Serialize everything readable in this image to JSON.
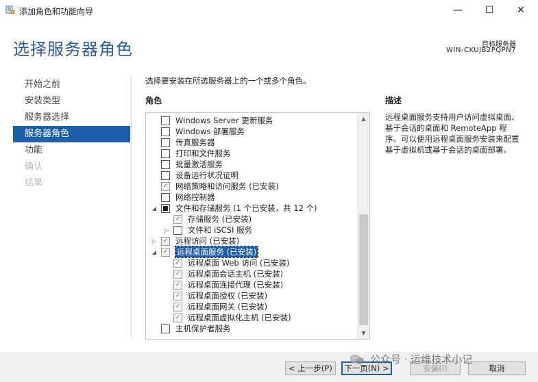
{
  "window": {
    "title": "添加角色和功能向导",
    "minimize": "—",
    "maximize": "☐",
    "close": "✕"
  },
  "header": {
    "page_title": "选择服务器角色",
    "dest_label": "目标服务器",
    "dest_server": "WIN-CKUJB2PQPN7"
  },
  "nav": {
    "items": [
      {
        "label": "开始之前",
        "state": "normal"
      },
      {
        "label": "安装类型",
        "state": "normal"
      },
      {
        "label": "服务器选择",
        "state": "normal"
      },
      {
        "label": "服务器角色",
        "state": "active"
      },
      {
        "label": "功能",
        "state": "normal"
      },
      {
        "label": "确认",
        "state": "disabled"
      },
      {
        "label": "结果",
        "state": "disabled"
      }
    ]
  },
  "main": {
    "instruction": "选择要安装在所选服务器上的一个或多个角色。",
    "roles_heading": "角色",
    "description_heading": "描述",
    "description_text": "远程桌面服务支持用户访问虚拟桌面、基于会话的桌面和 RemoteApp 程序。可以使用远程桌面服务安装来配置基于虚拟机或基于会话的桌面部署。"
  },
  "roles": [
    {
      "label": "Windows Server 更新服务",
      "level": 0,
      "expander": "",
      "check": "unchecked"
    },
    {
      "label": "Windows 部署服务",
      "level": 0,
      "expander": "",
      "check": "unchecked"
    },
    {
      "label": "传真服务器",
      "level": 0,
      "expander": "",
      "check": "unchecked"
    },
    {
      "label": "打印和文件服务",
      "level": 0,
      "expander": "",
      "check": "unchecked"
    },
    {
      "label": "批量激活服务",
      "level": 0,
      "expander": "",
      "check": "unchecked"
    },
    {
      "label": "设备运行状况证明",
      "level": 0,
      "expander": "",
      "check": "unchecked"
    },
    {
      "label": "网络策略和访问服务 (已安装)",
      "level": 0,
      "expander": "",
      "check": "installed"
    },
    {
      "label": "网络控制器",
      "level": 0,
      "expander": "",
      "check": "unchecked"
    },
    {
      "label": "文件和存储服务 (1 个已安装，共 12 个)",
      "level": 0,
      "expander": "expanded",
      "check": "partial"
    },
    {
      "label": "存储服务 (已安装)",
      "level": 1,
      "expander": "",
      "check": "installed"
    },
    {
      "label": "文件和 iSCSI 服务",
      "level": 1,
      "expander": "collapsed",
      "check": "unchecked"
    },
    {
      "label": "远程访问 (已安装)",
      "level": 0,
      "expander": "collapsed",
      "check": "installed"
    },
    {
      "label": "远程桌面服务 (已安装)",
      "level": 0,
      "expander": "expanded",
      "check": "installed",
      "selected": true
    },
    {
      "label": "远程桌面 Web 访问 (已安装)",
      "level": 1,
      "expander": "",
      "check": "installed"
    },
    {
      "label": "远程桌面会话主机 (已安装)",
      "level": 1,
      "expander": "",
      "check": "installed"
    },
    {
      "label": "远程桌面连接代理 (已安装)",
      "level": 1,
      "expander": "",
      "check": "installed"
    },
    {
      "label": "远程桌面授权 (已安装)",
      "level": 1,
      "expander": "",
      "check": "installed"
    },
    {
      "label": "远程桌面网关 (已安装)",
      "level": 1,
      "expander": "",
      "check": "installed"
    },
    {
      "label": "远程桌面虚拟化主机 (已安装)",
      "level": 1,
      "expander": "",
      "check": "installed"
    },
    {
      "label": "主机保护者服务",
      "level": 0,
      "expander": "",
      "check": "unchecked"
    }
  ],
  "scrollbar": {
    "up": "▲",
    "down": "▼"
  },
  "footer": {
    "prev": "< 上一步(P)",
    "next": "下一页(N) >",
    "install": "安装(I)",
    "cancel": "取消"
  },
  "watermark": "公众号 · 运维技术小记",
  "colors": {
    "accent": "#1f5ea8",
    "title": "#2a5aa0"
  }
}
